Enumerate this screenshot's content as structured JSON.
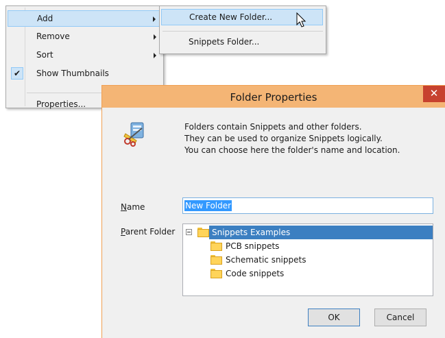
{
  "menu": {
    "items": [
      {
        "label": "Add",
        "has_submenu": true,
        "highlighted": true
      },
      {
        "label": "Remove",
        "has_submenu": true
      },
      {
        "label": "Sort",
        "has_submenu": true
      },
      {
        "label": "Show Thumbnails",
        "checked": true
      },
      {
        "label": "Properties..."
      }
    ],
    "check_glyph": "✔"
  },
  "submenu": {
    "items": [
      {
        "label": "Create New Folder...",
        "highlighted": true
      },
      {
        "label": "Snippets Folder..."
      }
    ]
  },
  "dialog": {
    "title": "Folder Properties",
    "close_glyph": "✕",
    "description": [
      "Folders contain Snippets and other folders.",
      "They can be used to organize Snippets logically.",
      "You can choose here the folder's name and location."
    ],
    "name_label_mnemonic": "N",
    "name_label_rest": "ame",
    "name_value": "New Folder",
    "parent_label_mnemonic": "P",
    "parent_label_rest": "arent Folder",
    "tree": {
      "root": "Snippets Examples",
      "children": [
        "PCB snippets",
        "Schematic snippets",
        "Code snippets"
      ]
    },
    "ok_label": "OK",
    "cancel_label": "Cancel"
  },
  "colors": {
    "title_bar": "#f4b575",
    "close_button": "#c7422f",
    "selection": "#3c7fc1",
    "menu_highlight": "#cde4f7"
  }
}
